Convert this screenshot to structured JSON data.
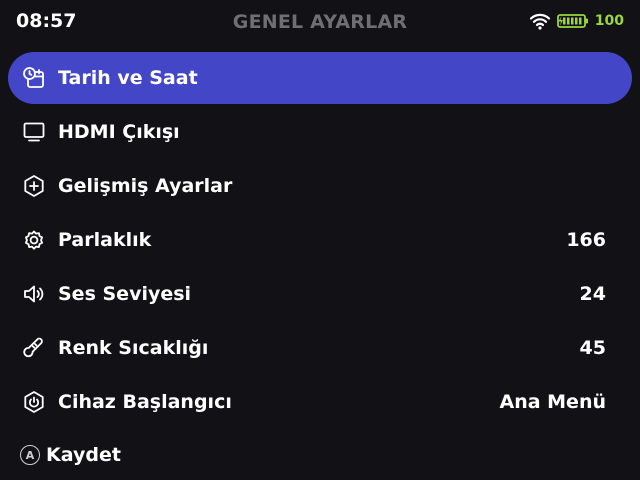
{
  "status": {
    "time": "08:57",
    "title": "GENEL AYARLAR",
    "battery_percent": "100",
    "wifi_icon": "wifi-icon",
    "battery_icon": "battery-charging-icon",
    "battery_color": "#9ad63d"
  },
  "menu": {
    "items": [
      {
        "label": "Tarih ve Saat",
        "value": "",
        "icon": "calendar-clock-icon",
        "selected": true
      },
      {
        "label": "HDMI Çıkışı",
        "value": "",
        "icon": "monitor-icon"
      },
      {
        "label": "Gelişmiş Ayarlar",
        "value": "",
        "icon": "hexagon-plus-icon"
      },
      {
        "label": "Parlaklık",
        "value": "166",
        "icon": "gear-icon"
      },
      {
        "label": "Ses Seviyesi",
        "value": "24",
        "icon": "speaker-icon"
      },
      {
        "label": "Renk Sıcaklığı",
        "value": "45",
        "icon": "thermometer-icon"
      },
      {
        "label": "Cihaz Başlangıcı",
        "value": "Ana Menü",
        "icon": "power-icon"
      }
    ]
  },
  "footer": {
    "button_glyph": "A",
    "action_label": "Kaydet"
  },
  "colors": {
    "background": "#121216",
    "selection": "#4346c6",
    "title_gray": "#6e6e74"
  }
}
